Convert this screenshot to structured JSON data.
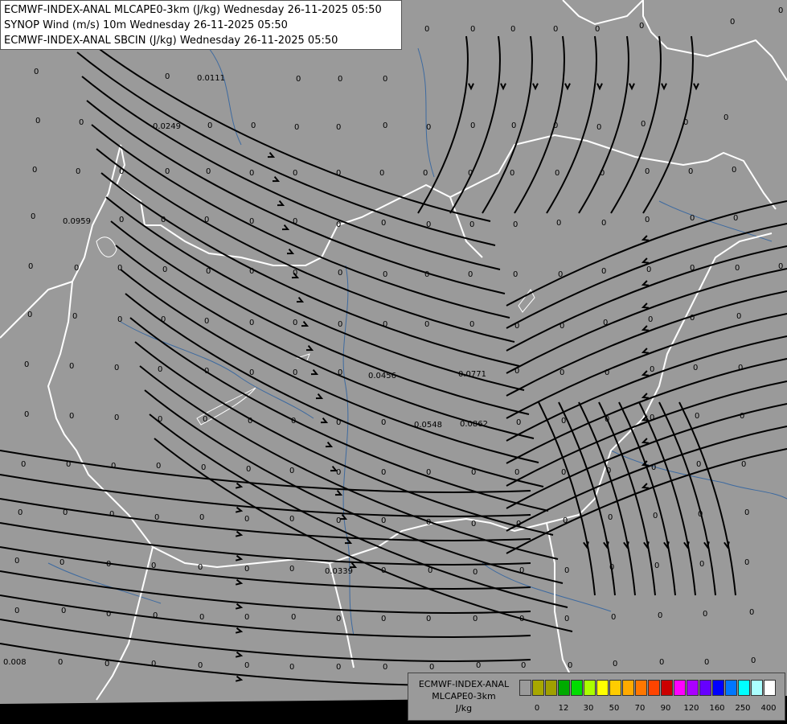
{
  "header": {
    "line1": "ECMWF-INDEX-ANAL MLCAPE0-3km (J/kg) Wednesday 26-11-2025 05:50",
    "line2": "SYNOP Wind (m/s) 10m Wednesday 26-11-2025 05:50",
    "line3": "ECMWF-INDEX-ANAL SBCIN (J/kg) Wednesday 26-11-2025 05:50"
  },
  "legend": {
    "title1": "ECMWF-INDEX-ANAL",
    "title2": "MLCAPE0-3km",
    "unit": "J/kg",
    "colors": [
      "#9a9a9a",
      "#a8a800",
      "#a0a000",
      "#00aa00",
      "#00dd00",
      "#aaff00",
      "#ffff00",
      "#ffcc00",
      "#ffaa00",
      "#ff7700",
      "#ff4400",
      "#cc0000",
      "#ff00ff",
      "#aa00ff",
      "#6600ff",
      "#0000ff",
      "#0077ff",
      "#00ffff",
      "#aaffff",
      "#ffffff"
    ],
    "ticks": [
      "0",
      "12",
      "30",
      "50",
      "70",
      "90",
      "120",
      "160",
      "250",
      "400"
    ]
  },
  "map_values": [
    "0.0111",
    "0.0249",
    "0.0959",
    "0.0456",
    "0.0771",
    "0.0548",
    "0.0862",
    "0.0339",
    "0.008",
    "0",
    "0",
    "0",
    "0",
    "0",
    "0",
    "0",
    "0",
    "0",
    "0",
    "0",
    "0",
    "0",
    "0",
    "0",
    "0",
    "0",
    "0",
    "0",
    "0",
    "0",
    "0",
    "0",
    "0",
    "0",
    "0",
    "0",
    "0",
    "0",
    "0",
    "0",
    "0",
    "0",
    "0",
    "0",
    "0",
    "0",
    "0",
    "0",
    "0"
  ],
  "colors": {
    "background": "#9a9a9a",
    "borders": "#ffffff",
    "rivers": "#3d6aa0",
    "streamlines": "#000000"
  }
}
